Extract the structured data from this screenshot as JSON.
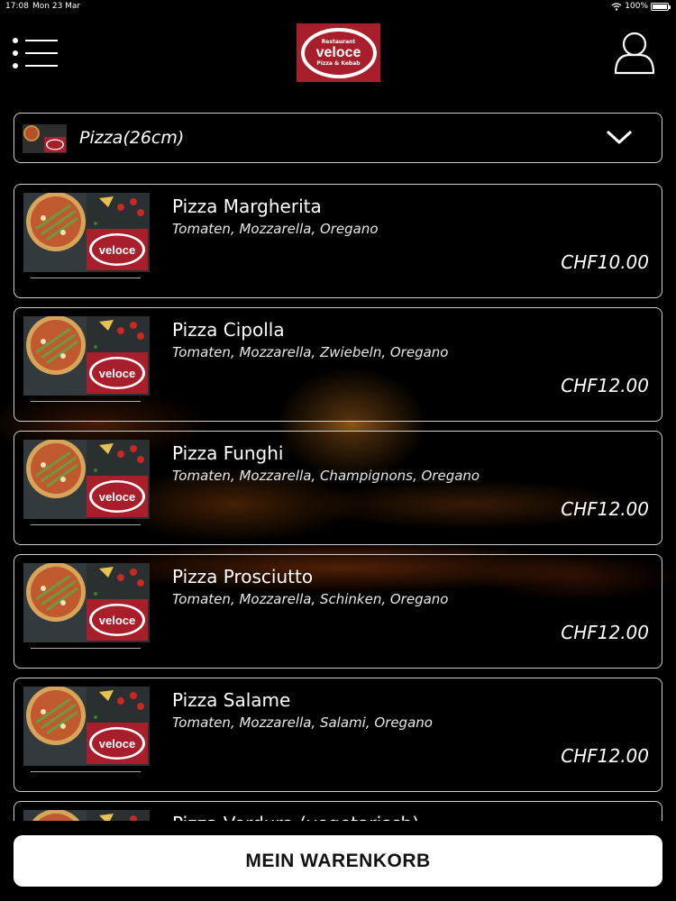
{
  "status_bar": {
    "time": "17:08",
    "date": "Mon 23 Mar",
    "battery": "100%"
  },
  "header": {
    "logo": {
      "top_text": "Restaurant",
      "main_text": "veloce",
      "bottom_text": "Pizza & Kebab"
    },
    "menu_icon": "menu-icon",
    "user_icon": "user-icon"
  },
  "category": {
    "label": "Pizza(26cm)",
    "icon": "chevron-down-icon"
  },
  "thumb_logo_text": "veloce",
  "items": [
    {
      "name": "Pizza Margherita",
      "description": "Tomaten, Mozzarella, Oregano",
      "price": "CHF10.00"
    },
    {
      "name": "Pizza Cipolla",
      "description": "Tomaten, Mozzarella, Zwiebeln, Oregano",
      "price": "CHF12.00"
    },
    {
      "name": "Pizza Funghi",
      "description": "Tomaten, Mozzarella, Champignons, Oregano",
      "price": "CHF12.00"
    },
    {
      "name": "Pizza Prosciutto",
      "description": "Tomaten, Mozzarella, Schinken, Oregano",
      "price": "CHF12.00"
    },
    {
      "name": "Pizza Salame",
      "description": "Tomaten, Mozzarella, Salami, Oregano",
      "price": "CHF12.00"
    },
    {
      "name": "Pizza Verdura (vegetarisch)",
      "description": "",
      "price": ""
    }
  ],
  "cart_button": {
    "label": "MEIN WARENKORB"
  },
  "colors": {
    "brand": "#a81e2a",
    "background": "#000000",
    "button": "#ffffff"
  }
}
